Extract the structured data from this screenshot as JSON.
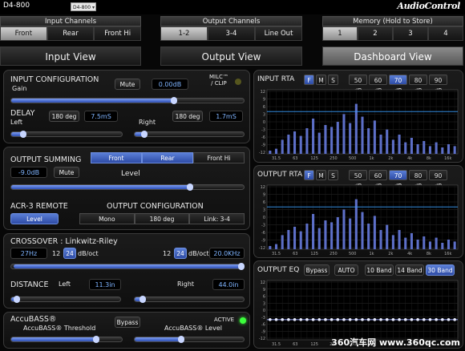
{
  "window": {
    "title": "D4-800",
    "preset": "D4-800",
    "brand": "AudioControl"
  },
  "groups": {
    "input": {
      "title": "Input Channels",
      "items": [
        "Front",
        "Rear",
        "Front Hi"
      ],
      "active": 0
    },
    "output": {
      "title": "Output Channels",
      "items": [
        "1-2",
        "3-4",
        "Line Out"
      ],
      "active": 0
    },
    "memory": {
      "title": "Memory (Hold to Store)",
      "items": [
        "1",
        "2",
        "3",
        "4"
      ],
      "active": 0
    }
  },
  "views": {
    "input": "Input View",
    "output": "Output View",
    "dashboard": "Dashboard View"
  },
  "input_config": {
    "title": "INPUT CONFIGURATION",
    "gain_label": "Gain",
    "mute": "Mute",
    "gain_value": "0.00dB",
    "milc": "MILC™\n/ CLIP",
    "gain_level": 0.7
  },
  "delay": {
    "title": "DELAY",
    "left": "Left",
    "right": "Right",
    "left_phase": "180 deg",
    "left_value": "7.5mS",
    "right_phase": "180 deg",
    "right_value": "1.7mS",
    "left_level": 0.11,
    "right_level": 0.09
  },
  "summing": {
    "title": "OUTPUT SUMMING",
    "tabs": [
      "Front",
      "Rear",
      "Front Hi"
    ],
    "value": "-9.0dB",
    "mute": "Mute",
    "level_label": "Level",
    "level": 0.77
  },
  "acr3": {
    "title": "ACR-3 REMOTE",
    "level": "Level",
    "out_title": "OUTPUT CONFIGURATION",
    "out_items": [
      "Mono",
      "180 deg",
      "Link: 3-4"
    ]
  },
  "crossover": {
    "title": "CROSSOVER : Linkwitz-Riley",
    "hp_freq": "27Hz",
    "hp_slope_a": "12",
    "hp_slope_b": "24",
    "hp_unit": "dB/oct",
    "lp_slope_a": "12",
    "lp_slope_b": "24",
    "lp_unit": "dB/oct",
    "lp_freq": "20.0KHz"
  },
  "distance": {
    "title": "DISTANCE",
    "left": "Left",
    "left_value": "11.3in",
    "right": "Right",
    "right_value": "44.0in",
    "left_level": 0.05,
    "right_level": 0.07
  },
  "accubass": {
    "title": "AccuBASS®",
    "threshold": "AccuBASS® Threshold",
    "bypass": "Bypass",
    "active": "ACTIVE",
    "level_label": "AccuBASS® Level",
    "threshold_level": 0.77,
    "level_level": 0.43
  },
  "rta": {
    "input_title": "INPUT RTA",
    "output_title": "OUTPUT RTA",
    "mode_buttons": [
      "F",
      "M",
      "S"
    ],
    "db_buttons": [
      "50 dB",
      "60 dB",
      "70 dB",
      "80 dB",
      "90 dB"
    ],
    "db_active": 2,
    "ticks": [
      "12",
      "9",
      "6",
      "3",
      "0",
      "-3",
      "-6",
      "-9",
      "-12"
    ],
    "freq_labels": [
      "31.5",
      "63",
      "125",
      "250",
      "500",
      "1k",
      "2k",
      "4k",
      "8k",
      "16k"
    ],
    "input_bars": [
      0.05,
      0.08,
      0.22,
      0.3,
      0.35,
      0.28,
      0.4,
      0.55,
      0.33,
      0.45,
      0.42,
      0.5,
      0.62,
      0.48,
      0.78,
      0.58,
      0.4,
      0.52,
      0.3,
      0.38,
      0.22,
      0.3,
      0.18,
      0.25,
      0.15,
      0.2,
      0.12,
      0.18,
      0.1,
      0.15,
      0.12
    ],
    "output_bars": [
      0.05,
      0.08,
      0.22,
      0.3,
      0.35,
      0.28,
      0.4,
      0.55,
      0.33,
      0.45,
      0.42,
      0.5,
      0.62,
      0.48,
      0.78,
      0.58,
      0.4,
      0.52,
      0.3,
      0.38,
      0.22,
      0.3,
      0.18,
      0.25,
      0.15,
      0.2,
      0.12,
      0.18,
      0.1,
      0.15,
      0.12
    ]
  },
  "eq": {
    "title": "OUTPUT EQ",
    "bypass": "Bypass",
    "auto": "AUTO",
    "bands": [
      "10 Band",
      "14 Band",
      "30 Band"
    ],
    "band_active": 2,
    "points": 31
  },
  "watermark": "360汽车网 www.360qc.com",
  "colors": {
    "accent": "#3f62c9",
    "bar": "#5d6fc8",
    "bar_line": "#3ba0ff",
    "led_clip": "#56561e",
    "led_active": "#3cff3c"
  }
}
